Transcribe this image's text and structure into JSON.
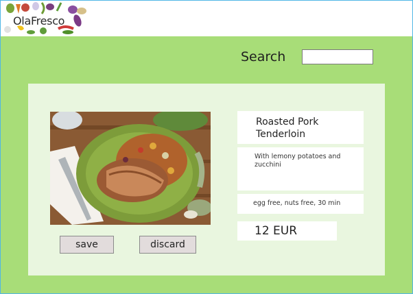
{
  "header": {
    "logo_text": "OlaFresco"
  },
  "search": {
    "label": "Search",
    "value": "",
    "placeholder": ""
  },
  "dish": {
    "title": "Roasted Pork Tenderloin",
    "description": "With lemony potatoes and zucchini",
    "tags": "egg free, nuts free, 30 min",
    "price": "12 EUR"
  },
  "actions": {
    "save_label": "save",
    "discard_label": "discard"
  },
  "colors": {
    "page_bg": "#a8dd78",
    "panel_bg": "#e9f6df",
    "button_bg": "#e2dcdc"
  }
}
